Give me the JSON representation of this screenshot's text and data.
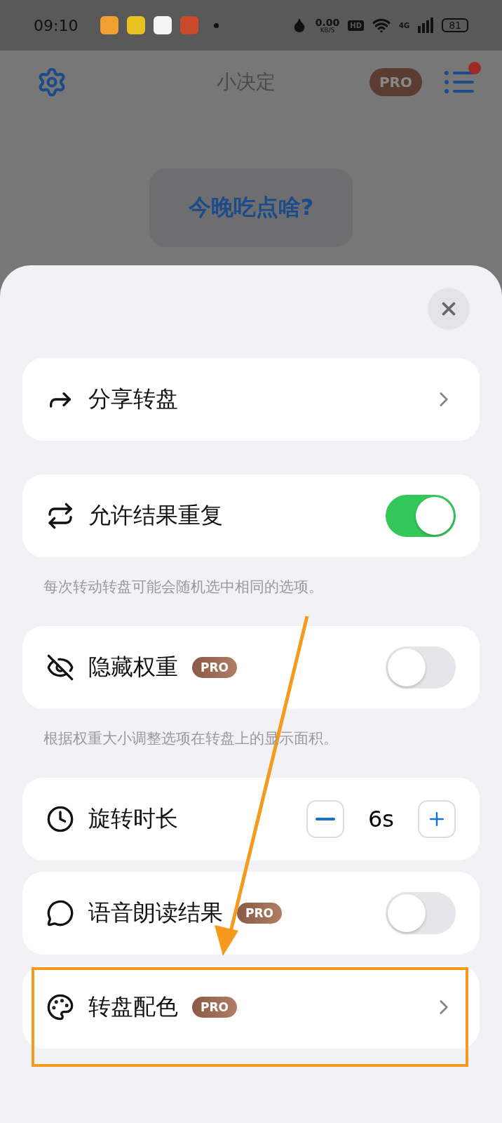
{
  "status_bar": {
    "time": "09:10",
    "speed": "0.00",
    "speed_unit": "KB/S",
    "hd": "HD",
    "network": "4G",
    "battery": "81"
  },
  "header": {
    "title": "小决定",
    "badge": "PRO",
    "notification": true
  },
  "question": "今晚吃点啥?",
  "sheet": {
    "rows": [
      {
        "kind": "link",
        "label": "分享转盘",
        "pro": false
      },
      {
        "kind": "toggle",
        "label": "允许结果重复",
        "pro": false,
        "on": true,
        "hint": "每次转动转盘可能会随机选中相同的选项。"
      },
      {
        "kind": "toggle",
        "label": "隐藏权重",
        "pro": true,
        "badge": "PRO",
        "on": false,
        "hint": "根据权重大小调整选项在转盘上的显示面积。"
      },
      {
        "kind": "stepper",
        "label": "旋转时长",
        "pro": false,
        "value": "6s"
      },
      {
        "kind": "toggle",
        "label": "语音朗读结果",
        "pro": true,
        "badge": "PRO",
        "on": false
      },
      {
        "kind": "link",
        "label": "转盘配色",
        "pro": true,
        "badge": "PRO",
        "highlighted": true
      }
    ]
  }
}
